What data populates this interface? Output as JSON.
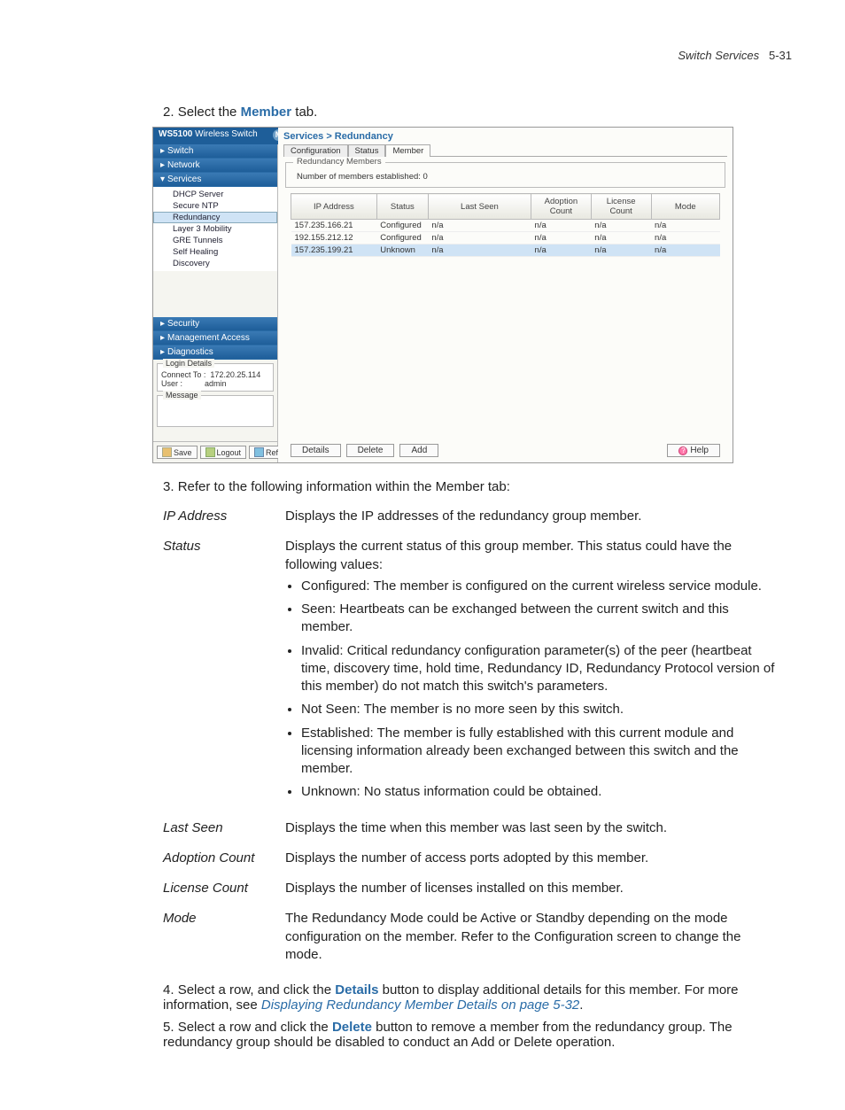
{
  "header": {
    "section": "Switch Services",
    "page_num": "5-31"
  },
  "steps": {
    "s2_pre": "Select the ",
    "s2_bold": "Member",
    "s2_post": " tab.",
    "s3": "Refer to the following information within the Member tab:",
    "s4_pre": "Select a row, and click the ",
    "s4_bold": "Details",
    "s4_post": " button to display additional details for this member. For more information, see ",
    "s4_link": "Displaying Redundancy Member Details on page 5-32",
    "s4_end": ".",
    "s5_pre": "Select a row and click the ",
    "s5_bold": "Delete",
    "s5_post": " button to remove a member from the redundancy group. The redundancy group should be disabled to conduct an Add or Delete operation."
  },
  "screenshot": {
    "title_bold": "WS5100",
    "title_thin": "Wireless Switch",
    "breadcrumb": "Services > Redundancy",
    "tabs": [
      "Configuration",
      "Status",
      "Member"
    ],
    "active_tab": 2,
    "sidebar": {
      "main": [
        "Switch",
        "Network",
        "Services"
      ],
      "sub": [
        "DHCP Server",
        "Secure NTP",
        "Redundancy",
        "Layer 3 Mobility",
        "GRE Tunnels",
        "Self Healing",
        "Discovery"
      ],
      "selected_sub": 2,
      "lower": [
        "Security",
        "Management Access",
        "Diagnostics"
      ]
    },
    "login": {
      "legend": "Login Details",
      "connect_label": "Connect To :",
      "connect_value": "172.20.25.114",
      "user_label": "User :",
      "user_value": "admin",
      "msg_legend": "Message"
    },
    "bottom_buttons": [
      "Save",
      "Logout",
      "Refresh"
    ],
    "fieldset_legend": "Redundancy Members",
    "count_line": "Number of members established: 0",
    "columns": [
      "IP Address",
      "Status",
      "Last Seen",
      "Adoption Count",
      "License Count",
      "Mode"
    ],
    "rows": [
      {
        "ip": "157.235.166.21",
        "status": "Configured",
        "last": "n/a",
        "adopt": "n/a",
        "lic": "n/a",
        "mode": "n/a",
        "sel": false
      },
      {
        "ip": "192.155.212.12",
        "status": "Configured",
        "last": "n/a",
        "adopt": "n/a",
        "lic": "n/a",
        "mode": "n/a",
        "sel": false
      },
      {
        "ip": "157.235.199.21",
        "status": "Unknown",
        "last": "n/a",
        "adopt": "n/a",
        "lic": "n/a",
        "mode": "n/a",
        "sel": true
      }
    ],
    "footer_buttons": [
      "Details",
      "Delete",
      "Add"
    ],
    "help_label": "Help"
  },
  "defs": {
    "ip_address": {
      "term": "IP Address",
      "desc": "Displays the IP addresses of the redundancy group member."
    },
    "status": {
      "term": "Status",
      "desc": "Displays the current status of this group member. This status could have the following values:",
      "bullets": [
        "Configured: The member is configured on the current wireless service module.",
        "Seen: Heartbeats can be exchanged between the current switch and this member.",
        "Invalid: Critical redundancy configuration parameter(s) of the peer (heartbeat time, discovery time, hold time, Redundancy ID, Redundancy Protocol version of this member) do not match this switch's parameters.",
        "Not Seen: The member is no more seen by this switch.",
        "Established: The member is fully established with this current module and licensing information already been exchanged between this switch and the member.",
        "Unknown: No status information could be obtained."
      ]
    },
    "last_seen": {
      "term": "Last Seen",
      "desc": "Displays the time when this member was last seen by the switch."
    },
    "adoption": {
      "term": "Adoption Count",
      "desc": "Displays the number of access ports adopted by this member."
    },
    "license": {
      "term": "License Count",
      "desc": "Displays the number of licenses installed on this member."
    },
    "mode": {
      "term": "Mode",
      "desc": "The Redundancy Mode could be Active or Standby depending on the mode configuration on the member. Refer to the Configuration screen to change the mode."
    }
  }
}
